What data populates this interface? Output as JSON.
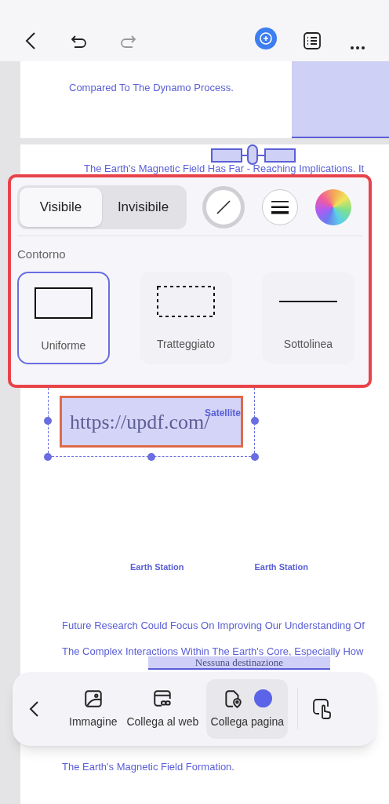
{
  "document": {
    "page_1": {
      "lines": [
        "Compared To The Dynamo Process."
      ]
    },
    "page_2": {
      "top_line": "The Earth's Magnetic Field Has Far - Reaching Implications. It",
      "link": {
        "text": "https://updf.com/",
        "label": "Satellite"
      },
      "stations": [
        "Earth Station",
        "Earth Station"
      ],
      "lines": [
        "Future Research Could Focus On Improving Our Understanding Of",
        "The Complex Interactions Within The Earth's Core, Especially How"
      ],
      "tooltip": "Nessuna destinazione",
      "last_line": "The Earth's Magnetic Field Formation."
    }
  },
  "popover": {
    "visibility": [
      {
        "label": "Visibile",
        "selected": true
      },
      {
        "label": "Invisibile",
        "selected": false
      }
    ],
    "tools": [
      {
        "kind": "line-style",
        "selected": true
      },
      {
        "kind": "line-weight",
        "selected": false
      },
      {
        "kind": "color",
        "selected": false
      }
    ],
    "section_title": "Contorno",
    "outline_styles": [
      {
        "kind": "solid",
        "label": "Uniforme",
        "selected": true
      },
      {
        "kind": "dashed",
        "label": "Tratteggiato",
        "selected": false
      },
      {
        "kind": "underline",
        "label": "Sottolinea",
        "selected": false
      }
    ]
  },
  "toolbar": {
    "items": [
      {
        "kind": "image",
        "label": "Immagine",
        "selected": false
      },
      {
        "kind": "web",
        "label": "Collega al web",
        "selected": false
      },
      {
        "kind": "page",
        "label": "Collega pagina",
        "selected": true,
        "color": "#5b63e8"
      }
    ]
  }
}
